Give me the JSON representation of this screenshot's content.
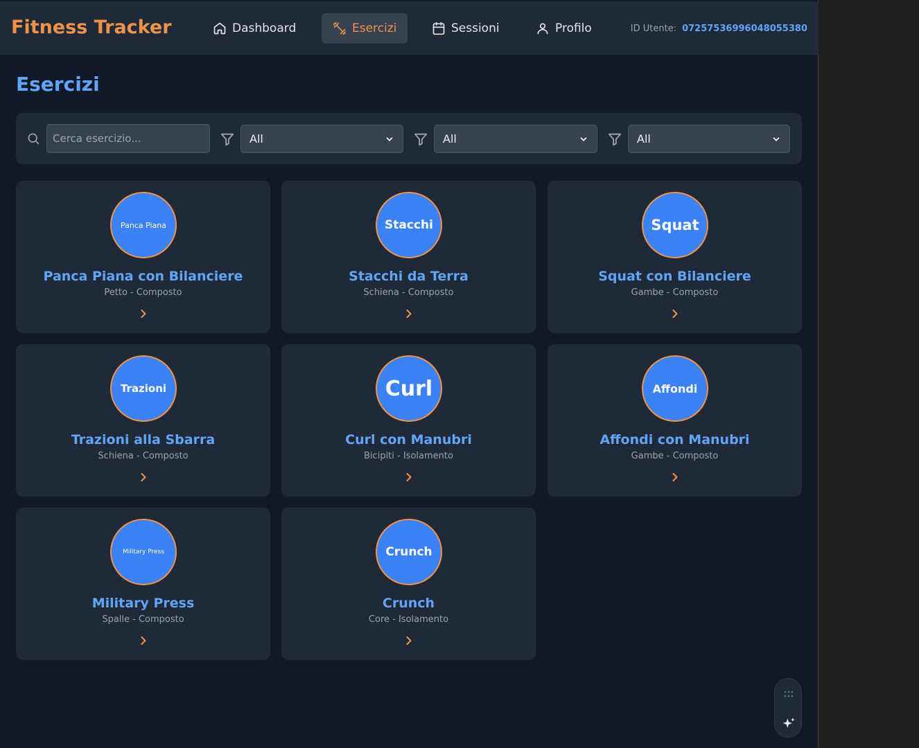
{
  "app": {
    "brand": "Fitness Tracker"
  },
  "nav": {
    "items": [
      {
        "label": "Dashboard",
        "icon": "home-icon"
      },
      {
        "label": "Esercizi",
        "icon": "dumbbell-icon",
        "active": true
      },
      {
        "label": "Sessioni",
        "icon": "calendar-icon"
      },
      {
        "label": "Profilo",
        "icon": "user-icon"
      }
    ],
    "user_id_label": "ID Utente:",
    "user_id_value": "07257536996048055380"
  },
  "page": {
    "title": "Esercizi"
  },
  "filters": {
    "search_placeholder": "Cerca esercizio...",
    "selects": [
      "All",
      "All",
      "All"
    ]
  },
  "exercises": [
    {
      "avatar_text": "Panca Piana",
      "name": "Panca Piana con Bilanciere",
      "meta": "Petto - Composto"
    },
    {
      "avatar_text": "Stacchi",
      "name": "Stacchi da Terra",
      "meta": "Schiena - Composto"
    },
    {
      "avatar_text": "Squat",
      "name": "Squat con Bilanciere",
      "meta": "Gambe - Composto"
    },
    {
      "avatar_text": "Trazioni",
      "name": "Trazioni alla Sbarra",
      "meta": "Schiena - Composto"
    },
    {
      "avatar_text": "Curl",
      "name": "Curl con Manubri",
      "meta": "Bicipiti - Isolamento"
    },
    {
      "avatar_text": "Affondi",
      "name": "Affondi con Manubri",
      "meta": "Gambe - Composto"
    },
    {
      "avatar_text": "Military Press",
      "name": "Military Press",
      "meta": "Spalle - Composto"
    },
    {
      "avatar_text": "Crunch",
      "name": "Crunch",
      "meta": "Core - Isolamento"
    }
  ],
  "colors": {
    "accent": "#f0934a",
    "primary": "#60a5fa",
    "avatar_bg": "#3b82f6",
    "bg": "#111827",
    "card": "#1f2937"
  }
}
